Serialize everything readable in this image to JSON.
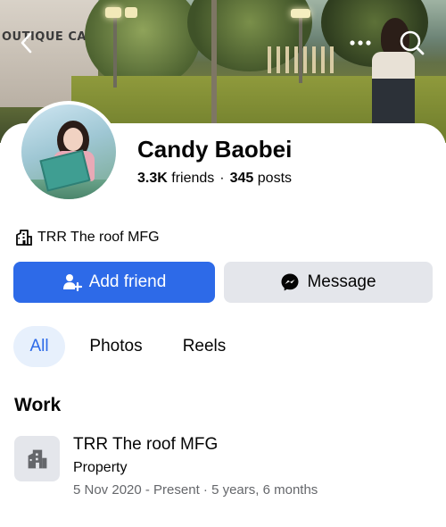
{
  "cover": {
    "sign_text": "OUTIQUE  CAFE"
  },
  "profile": {
    "name": "Candy Baobei",
    "friends_count": "3.3K",
    "friends_label": "friends",
    "separator": "·",
    "posts_count": "345",
    "posts_label": "posts",
    "workplace": "TRR The roof MFG"
  },
  "actions": {
    "add_friend": "Add friend",
    "message": "Message"
  },
  "tabs": [
    {
      "label": "All",
      "selected": true
    },
    {
      "label": "Photos",
      "selected": false
    },
    {
      "label": "Reels",
      "selected": false
    }
  ],
  "work": {
    "section_title": "Work",
    "employer": "TRR The roof MFG",
    "category": "Property",
    "dates": "5 Nov 2020 - Present · 5 years, 6 months"
  },
  "colors": {
    "accent": "#2d6ae8",
    "secondary_button": "#e4e6eb",
    "selected_tab_bg": "#e7f0fc",
    "muted_text": "#65676b"
  },
  "icons": {
    "back": "chevron-left-icon",
    "more": "more-dots-icon",
    "search": "search-icon",
    "workplace": "building-icon",
    "add_friend": "add-person-icon",
    "message": "messenger-icon"
  }
}
